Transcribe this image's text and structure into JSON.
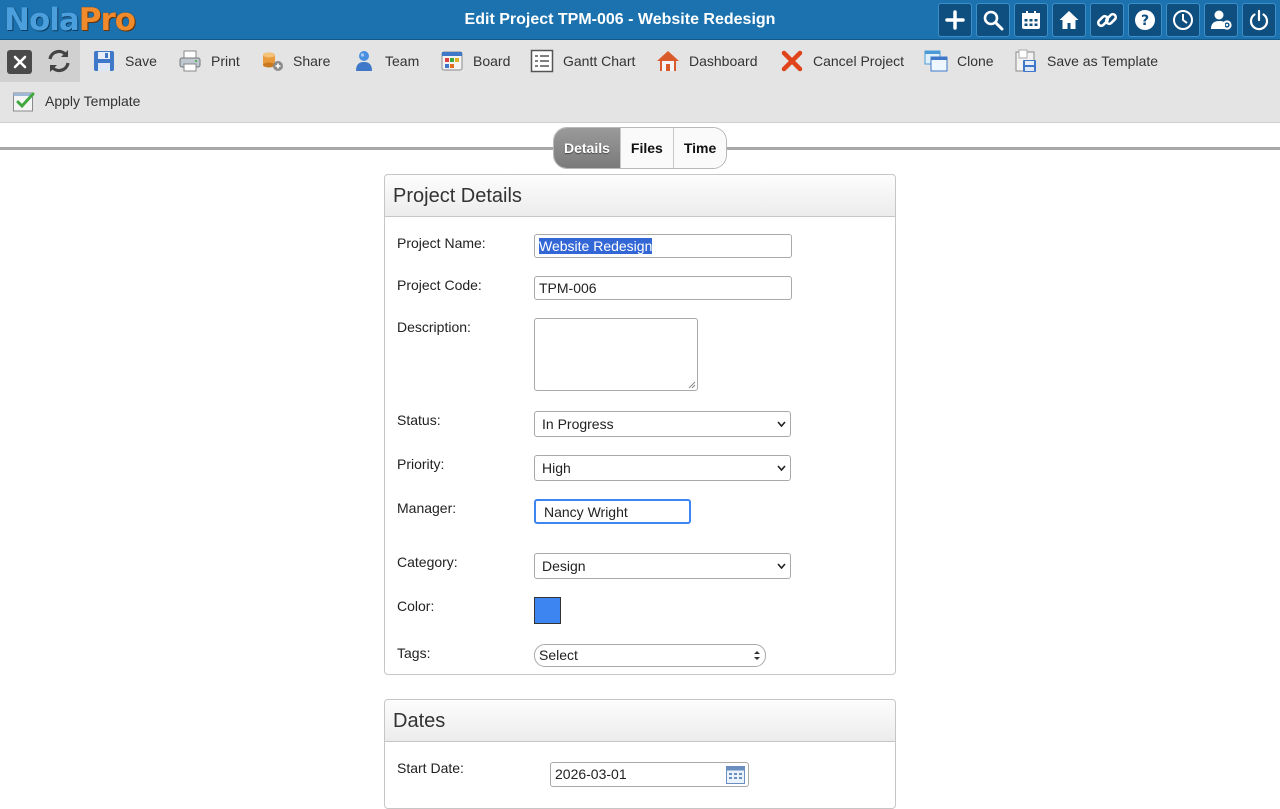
{
  "app": {
    "logo_part1": "Nola",
    "logo_part2": "Pro",
    "title": "Edit Project TPM-006 - Website Redesign"
  },
  "header_icons": [
    "plus-icon",
    "search-icon",
    "calendar-icon",
    "home-icon",
    "link-icon",
    "help-icon",
    "clock-icon",
    "user-settings-icon",
    "power-icon"
  ],
  "toolbar": {
    "save": "Save",
    "print": "Print",
    "share": "Share",
    "team": "Team",
    "board": "Board",
    "gantt": "Gantt Chart",
    "dashboard": "Dashboard",
    "cancel_project": "Cancel Project",
    "clone": "Clone",
    "save_as_template": "Save as Template",
    "apply_template": "Apply Template"
  },
  "tabs": {
    "details": "Details",
    "files": "Files",
    "time": "Time"
  },
  "project_details": {
    "heading": "Project Details",
    "name_label": "Project Name:",
    "name_value": "Website Redesign",
    "code_label": "Project Code:",
    "code_value": "TPM-006",
    "description_label": "Description:",
    "description_value": "",
    "status_label": "Status:",
    "status_value": "In Progress",
    "priority_label": "Priority:",
    "priority_value": "High",
    "manager_label": "Manager:",
    "manager_value": "Nancy Wright",
    "category_label": "Category:",
    "category_value": "Design",
    "color_label": "Color:",
    "color_value": "#3d85f0",
    "tags_label": "Tags:",
    "tags_value": "Select"
  },
  "dates": {
    "heading": "Dates",
    "start_label": "Start Date:",
    "start_value": "2026-03-01"
  },
  "colors": {
    "header_bg": "#1b72ae",
    "toolbar_bg": "#e4e4e4",
    "accent_blue": "#3d85f0",
    "active_tab": "#858585"
  }
}
